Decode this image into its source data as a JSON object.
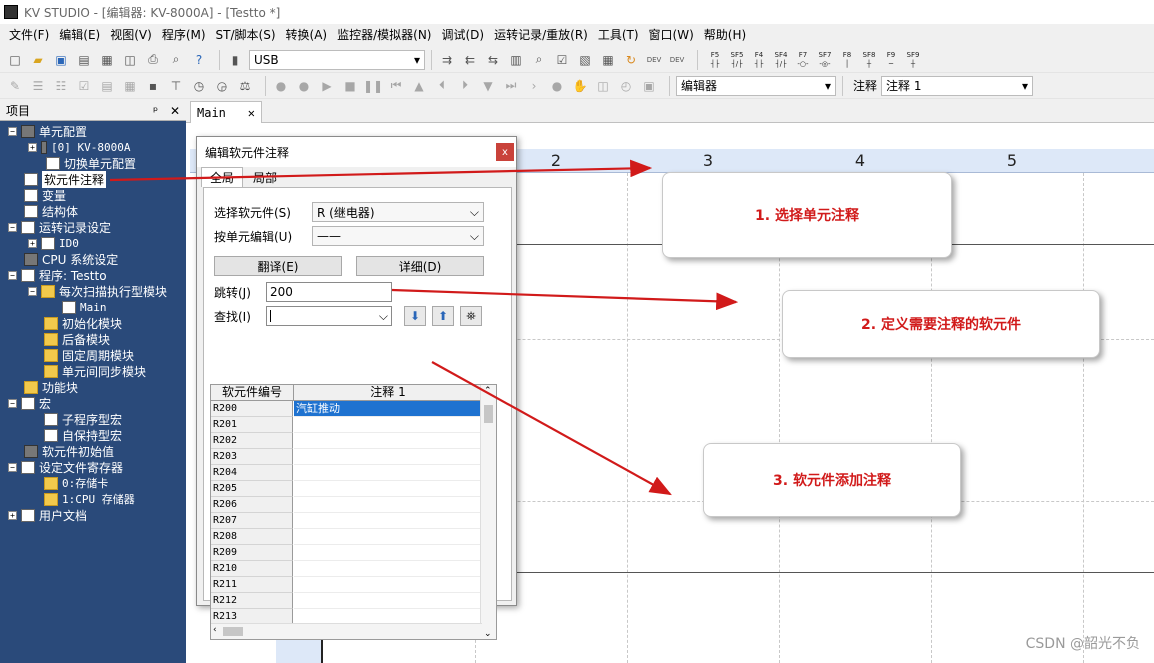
{
  "window": {
    "title": "KV STUDIO - [编辑器: KV-8000A] - [Testto *]"
  },
  "menu": [
    "文件(F)",
    "编辑(E)",
    "视图(V)",
    "程序(M)",
    "ST/脚本(S)",
    "转换(A)",
    "监控器/模拟器(N)",
    "调试(D)",
    "运转记录/重放(R)",
    "工具(T)",
    "窗口(W)",
    "帮助(H)"
  ],
  "toolbar1": {
    "connection": "USB",
    "fkeys": [
      "F5",
      "SF5",
      "F4",
      "SF4",
      "F7",
      "SF7",
      "F8",
      "SF8",
      "F9",
      "SF9"
    ]
  },
  "toolbar2": {
    "mode": "编辑器",
    "comment_label": "注释",
    "comment_value": "注释 1"
  },
  "project_panel": {
    "title": "项目",
    "pin": "ᵖ",
    "close": "✕",
    "items": [
      {
        "label": "单元配置",
        "exp": "−"
      },
      {
        "label": "[0]  KV-8000A",
        "exp": "+"
      },
      {
        "label": "切换单元配置",
        "exp": ""
      },
      {
        "label": "软元件注释",
        "exp": ""
      },
      {
        "label": "变量",
        "exp": ""
      },
      {
        "label": "结构体",
        "exp": ""
      },
      {
        "label": "运转记录设定",
        "exp": "−"
      },
      {
        "label": "ID0",
        "exp": "+"
      },
      {
        "label": "CPU 系统设定",
        "exp": ""
      },
      {
        "label": "程序: Testto",
        "exp": "−"
      },
      {
        "label": "每次扫描执行型模块",
        "exp": "−"
      },
      {
        "label": "Main",
        "exp": ""
      },
      {
        "label": "初始化模块",
        "exp": ""
      },
      {
        "label": "后备模块",
        "exp": ""
      },
      {
        "label": "固定周期模块",
        "exp": ""
      },
      {
        "label": "单元间同步模块",
        "exp": ""
      },
      {
        "label": "功能块",
        "exp": ""
      },
      {
        "label": "宏",
        "exp": "−"
      },
      {
        "label": "子程序型宏",
        "exp": ""
      },
      {
        "label": "自保持型宏",
        "exp": ""
      },
      {
        "label": "软元件初始值",
        "exp": ""
      },
      {
        "label": "设定文件寄存器",
        "exp": "−"
      },
      {
        "label": "0:存储卡",
        "exp": ""
      },
      {
        "label": "1:CPU 存储器",
        "exp": ""
      },
      {
        "label": "用户文档",
        "exp": "+"
      }
    ]
  },
  "editor": {
    "tab": "Main",
    "tab_close": "✕",
    "columns": [
      "2",
      "3",
      "4",
      "5"
    ]
  },
  "dialog": {
    "title": "编辑软元件注释",
    "close": "x",
    "tabs": [
      "全局",
      "局部"
    ],
    "select_device_label": "选择软元件(S)",
    "select_device_value": "R (继电器)",
    "per_unit_label": "按单元编辑(U)",
    "per_unit_value": "——",
    "translate_button": "翻译(E)",
    "detail_button": "详细(D)",
    "jump_label": "跳转(J)",
    "jump_value": "200",
    "find_label": "查找(I)",
    "find_value": "",
    "grid_headers": [
      "软元件编号",
      "注释 1"
    ],
    "rows": [
      {
        "device": "R200",
        "comment": "汽缸推动"
      },
      {
        "device": "R201",
        "comment": ""
      },
      {
        "device": "R202",
        "comment": ""
      },
      {
        "device": "R203",
        "comment": ""
      },
      {
        "device": "R204",
        "comment": ""
      },
      {
        "device": "R205",
        "comment": ""
      },
      {
        "device": "R206",
        "comment": ""
      },
      {
        "device": "R207",
        "comment": ""
      },
      {
        "device": "R208",
        "comment": ""
      },
      {
        "device": "R209",
        "comment": ""
      },
      {
        "device": "R210",
        "comment": ""
      },
      {
        "device": "R211",
        "comment": ""
      },
      {
        "device": "R212",
        "comment": ""
      },
      {
        "device": "R213",
        "comment": ""
      }
    ]
  },
  "callouts": [
    "1. 选择单元注释",
    "2. 定义需要注释的软元件",
    "3. 软元件添加注释"
  ],
  "watermark": "CSDN @韶光不负",
  "colors": {
    "panel_bg": "#2a4a7a",
    "highlight": "#1e72d0",
    "arrow": "#d11a1a",
    "header_bg": "#dde8f8"
  }
}
